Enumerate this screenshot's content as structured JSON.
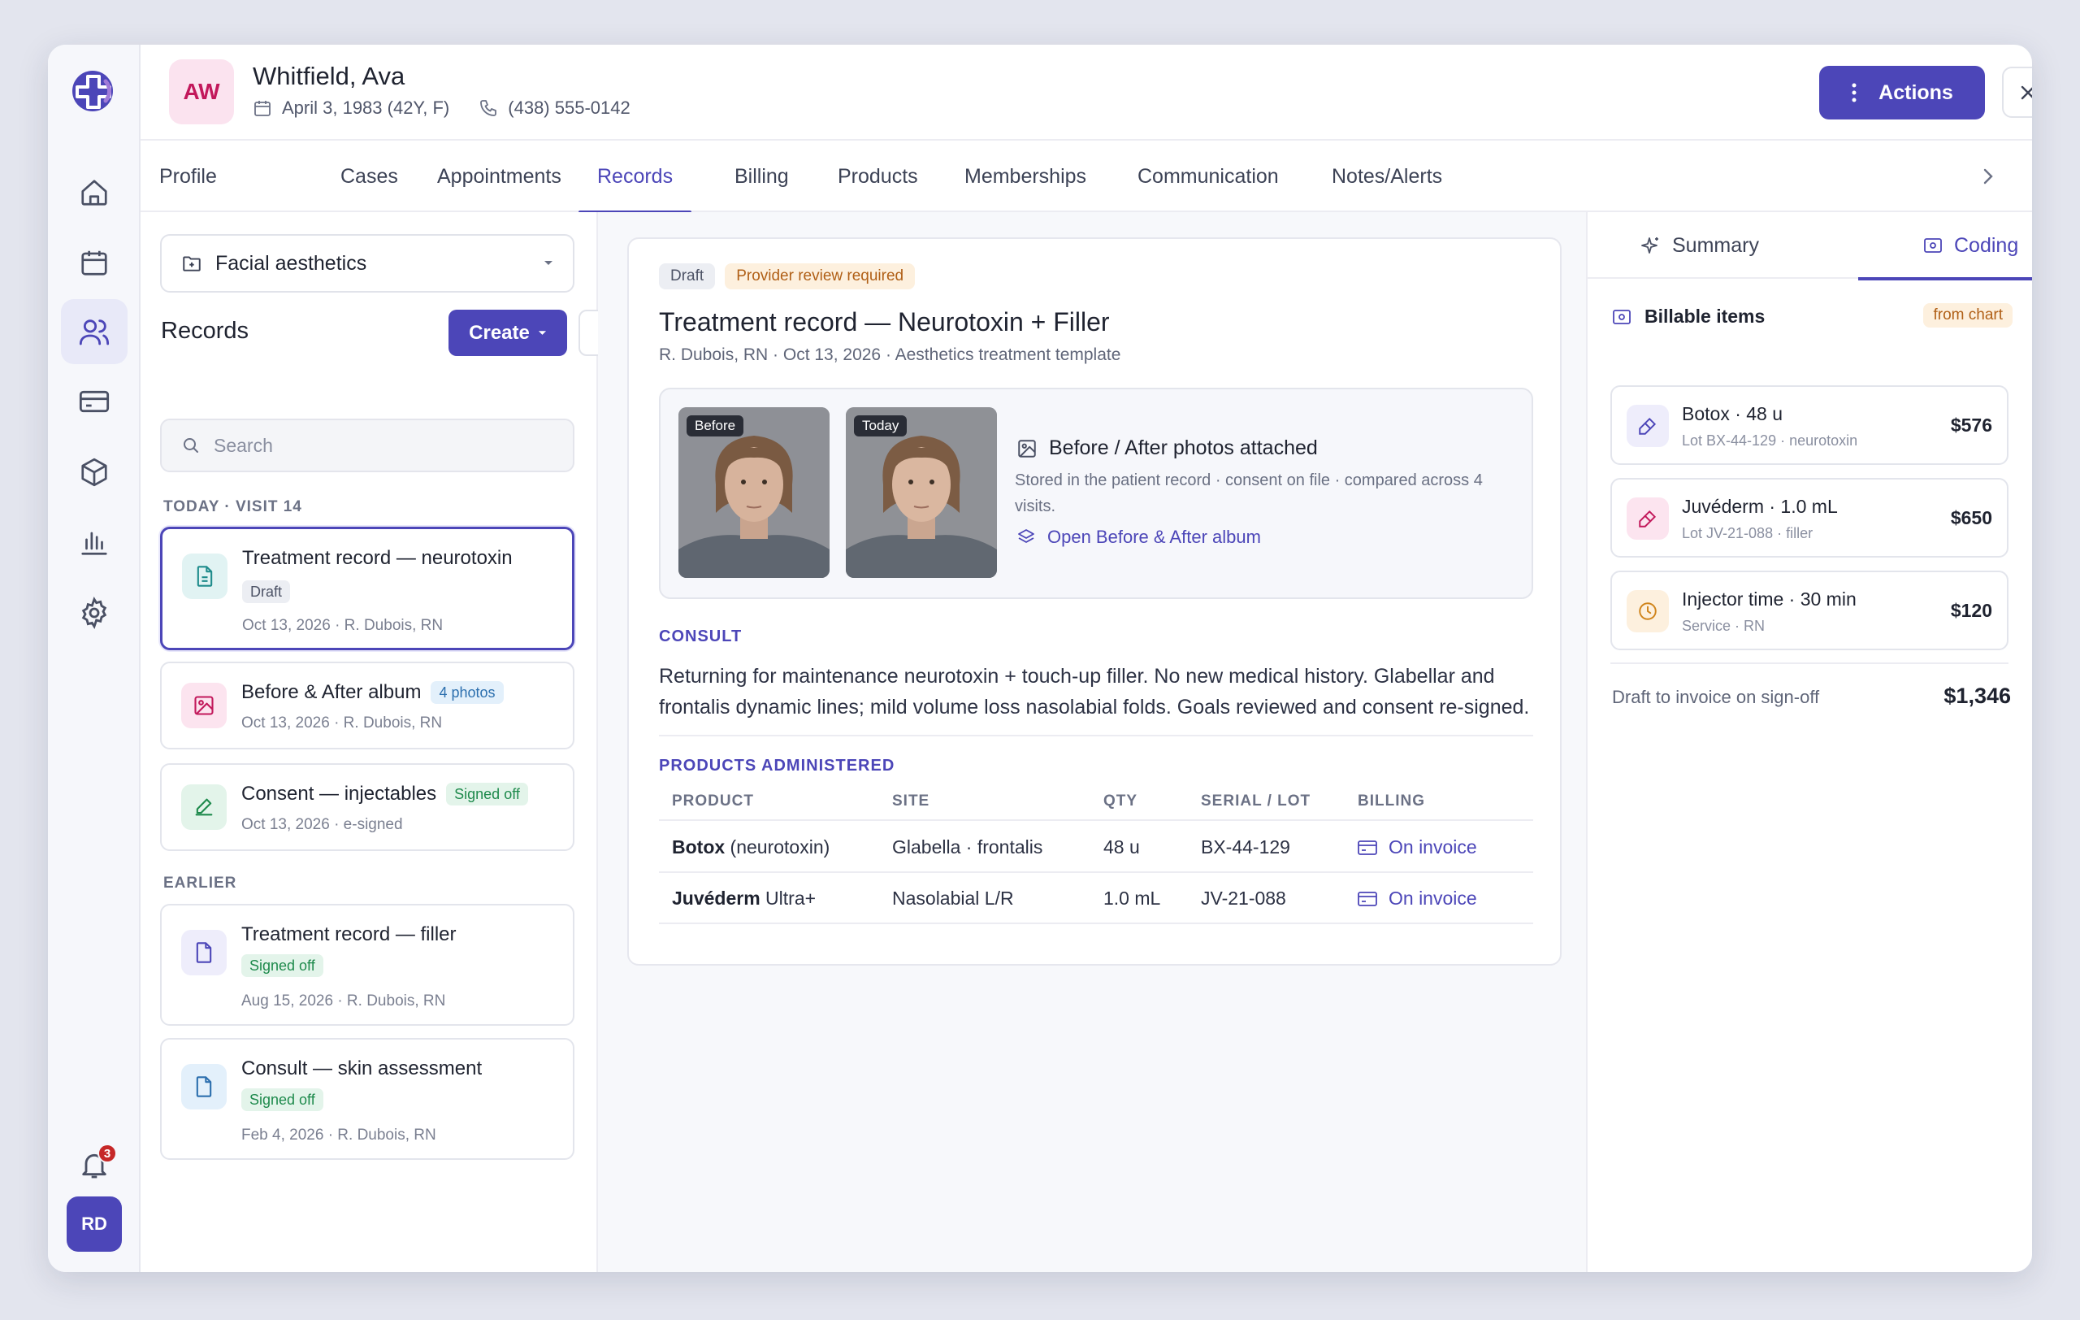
{
  "patient": {
    "initials": "AW",
    "name": "Whitfield, Ava",
    "dob": "April 3, 1983 (42Y, F)",
    "phone": "(438) 555-0142"
  },
  "header": {
    "actions_label": "Actions"
  },
  "user_initials": "RD",
  "notifications_count": "3",
  "tabs": [
    {
      "label": "Profile"
    },
    {
      "label": "Cases"
    },
    {
      "label": "Appointments"
    },
    {
      "label": "Records",
      "active": true
    },
    {
      "label": "Billing"
    },
    {
      "label": "Products"
    },
    {
      "label": "Memberships"
    },
    {
      "label": "Communication"
    },
    {
      "label": "Notes/Alerts"
    }
  ],
  "left": {
    "facet": "Facial aesthetics",
    "title": "Records",
    "create_label": "Create",
    "search_placeholder": "Search",
    "group_today": "TODAY · VISIT 14",
    "group_earlier": "EARLIER",
    "today": [
      {
        "title": "Treatment record — neurotoxin",
        "badge": "Draft",
        "meta": "Oct 13, 2026 · R. Dubois, RN"
      },
      {
        "title": "Before & After album",
        "badge": "4 photos",
        "meta": "Oct 13, 2026 · R. Dubois, RN"
      },
      {
        "title": "Consent — injectables",
        "badge": "Signed off",
        "meta": "Oct 13, 2026 · e-signed"
      }
    ],
    "earlier": [
      {
        "title": "Treatment record — filler",
        "badge": "Signed off",
        "meta": "Aug 15, 2026 · R. Dubois, RN"
      },
      {
        "title": "Consult — skin assessment",
        "badge": "Signed off",
        "meta": "Feb 4, 2026 · R. Dubois, RN"
      }
    ]
  },
  "record": {
    "status": "Draft",
    "flag": "Provider review required",
    "title": "Treatment record — Neurotoxin + Filler",
    "subtitle": "R. Dubois, RN · Oct 13, 2026 · Aesthetics treatment template",
    "photos": {
      "before_label": "Before",
      "today_label": "Today",
      "title": "Before / After photos attached",
      "description": "Stored in the patient record · consent on file · compared across 4 visits.",
      "link": "Open Before & After album"
    },
    "consult_heading": "CONSULT",
    "consult_text": "Returning for maintenance neurotoxin + touch-up filler. No new medical history. Glabellar and frontalis dynamic lines; mild volume loss nasolabial folds. Goals reviewed and consent re-signed.",
    "products_heading": "PRODUCTS ADMINISTERED",
    "columns": [
      "PRODUCT",
      "SITE",
      "QTY",
      "SERIAL / LOT",
      "BILLING"
    ],
    "products": [
      {
        "brand": "Botox",
        "rest": " (neurotoxin)",
        "site": "Glabella · frontalis",
        "qty": "48 u",
        "lot": "BX-44-129",
        "billing": "On invoice"
      },
      {
        "brand": "Juvéderm",
        "rest": " Ultra+",
        "site": "Nasolabial L/R",
        "qty": "1.0 mL",
        "lot": "JV-21-088",
        "billing": "On invoice"
      }
    ]
  },
  "right": {
    "tab_summary": "Summary",
    "tab_coding": "Coding",
    "billable_heading": "Billable items",
    "source_badge": "from chart",
    "items": [
      {
        "name": "Botox · 48 u",
        "sub": "Lot BX-44-129 · neurotoxin",
        "price": "$576"
      },
      {
        "name": "Juvéderm · 1.0 mL",
        "sub": "Lot JV-21-088 · filler",
        "price": "$650"
      },
      {
        "name": "Injector time · 30 min",
        "sub": "Service · RN",
        "price": "$120"
      }
    ],
    "total_label": "Draft to invoice on sign-off",
    "total_value": "$1,346"
  },
  "colors": {
    "accent": "#4c46b8",
    "success": "#1e8a4c",
    "warning": "#b05f16",
    "notification": "#c62828"
  }
}
